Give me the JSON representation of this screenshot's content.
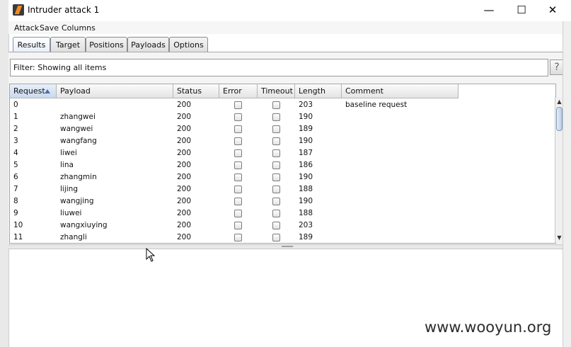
{
  "window": {
    "title": "Intruder attack 1",
    "minimize": "—",
    "maximize": "☐",
    "close": "✕"
  },
  "menu": [
    "Attack",
    "Save",
    "Columns"
  ],
  "tabs": [
    {
      "label": "Results",
      "active": true
    },
    {
      "label": "Target",
      "active": false
    },
    {
      "label": "Positions",
      "active": false
    },
    {
      "label": "Payloads",
      "active": false
    },
    {
      "label": "Options",
      "active": false
    }
  ],
  "filter": {
    "text": "Filter:  Showing all items",
    "help": "?"
  },
  "columns": [
    "Request",
    "Payload",
    "Status",
    "Error",
    "Timeout",
    "Length",
    "Comment"
  ],
  "sorted_column": "Request",
  "rows": [
    {
      "request": "0",
      "payload": "",
      "status": "200",
      "length": "203",
      "comment": "baseline request"
    },
    {
      "request": "1",
      "payload": "zhangwei",
      "status": "200",
      "length": "190",
      "comment": ""
    },
    {
      "request": "2",
      "payload": "wangwei",
      "status": "200",
      "length": "189",
      "comment": ""
    },
    {
      "request": "3",
      "payload": "wangfang",
      "status": "200",
      "length": "190",
      "comment": ""
    },
    {
      "request": "4",
      "payload": "liwei",
      "status": "200",
      "length": "187",
      "comment": ""
    },
    {
      "request": "5",
      "payload": "lina",
      "status": "200",
      "length": "186",
      "comment": ""
    },
    {
      "request": "6",
      "payload": "zhangmin",
      "status": "200",
      "length": "190",
      "comment": ""
    },
    {
      "request": "7",
      "payload": "lijing",
      "status": "200",
      "length": "188",
      "comment": ""
    },
    {
      "request": "8",
      "payload": "wangjing",
      "status": "200",
      "length": "190",
      "comment": ""
    },
    {
      "request": "9",
      "payload": "liuwei",
      "status": "200",
      "length": "188",
      "comment": ""
    },
    {
      "request": "10",
      "payload": "wangxiuying",
      "status": "200",
      "length": "203",
      "comment": ""
    },
    {
      "request": "11",
      "payload": "zhangli",
      "status": "200",
      "length": "189",
      "comment": ""
    }
  ],
  "watermark": "www.wooyun.org",
  "colors": {
    "active_tab": "#e6eef8",
    "accent": "#4a6fa8",
    "app_icon": "#f08a24"
  }
}
